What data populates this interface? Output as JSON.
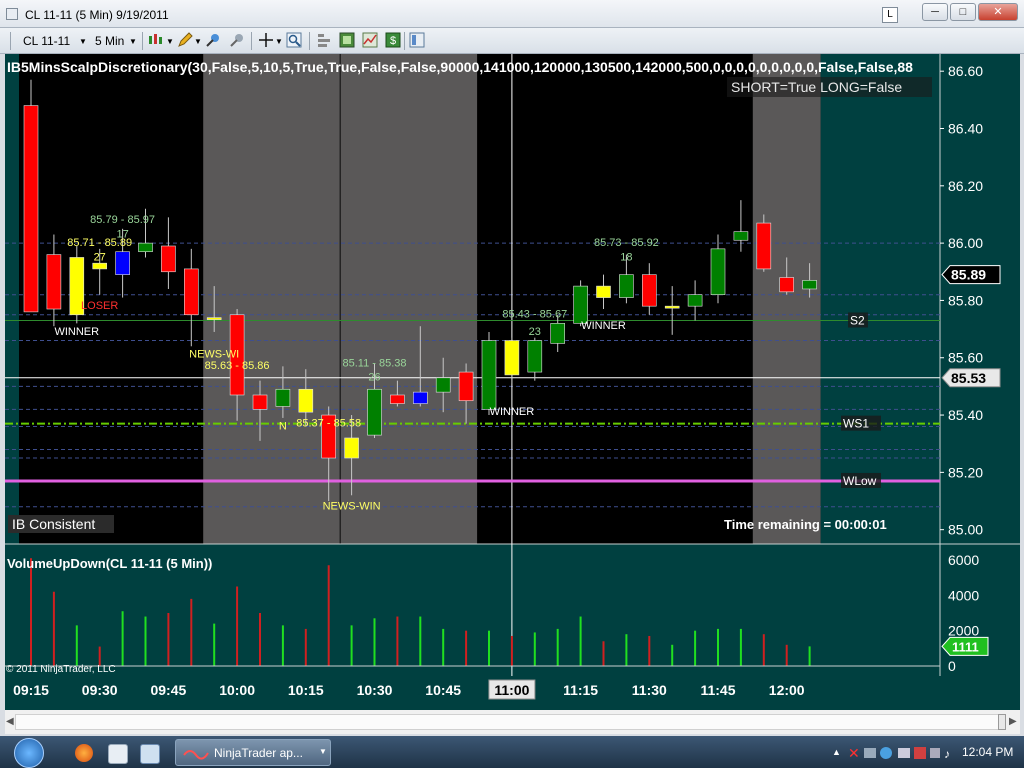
{
  "window": {
    "title": "CL 11-11 (5 Min)  9/19/2011",
    "layout_button": "L",
    "minimize": "─",
    "maximize": "□",
    "close": "✕"
  },
  "toolbar": {
    "instrument": "CL 11-11",
    "interval": "5 Min",
    "icons": [
      "bar-type-icon",
      "pencil-icon",
      "marker-icon",
      "pin-icon",
      "crosshair-icon",
      "zoom-icon",
      "properties-icon",
      "data-box-icon",
      "chart-trader-icon",
      "dollar-icon",
      "template-icon"
    ]
  },
  "chart_data": [
    {
      "type": "candlestick",
      "title": "IB5MinsScalpDiscretionary(30,False,5,10,5,True,True,False,False,90000,141000,120000,130500,142000,500,0,0,0,0,0,0,0,0,0,False,False,88",
      "subtitle": "SHORT=True LONG=False",
      "ylim": [
        84.95,
        86.66
      ],
      "yticks": [
        "86.60",
        "86.40",
        "86.20",
        "86.00",
        "85.80",
        "85.60",
        "85.40",
        "85.20",
        "85.00"
      ],
      "price_flags": [
        {
          "label": "85.89",
          "value": 85.89,
          "style": "dark"
        },
        {
          "label": "85.53",
          "value": 85.53,
          "style": "light"
        }
      ],
      "levels": [
        {
          "name": "S2",
          "value": 85.73,
          "color": "#2e8b2e"
        },
        {
          "name": "WS1",
          "value": 85.37,
          "color": "#66cc00"
        },
        {
          "name": "WLow",
          "value": 85.17,
          "color": "#e060e0"
        }
      ],
      "gridlines": [
        86.0,
        85.82,
        85.75,
        85.66,
        85.5,
        85.42,
        85.36,
        85.28,
        85.25,
        85.08
      ],
      "crosshair": {
        "price": 85.53,
        "time": "11:00"
      },
      "shaded_bands": [
        {
          "from": "09:55",
          "to": "10:20"
        },
        {
          "from": "10:25",
          "to": "10:50"
        },
        {
          "from": "11:55",
          "to": "12:05"
        }
      ],
      "candles": [
        {
          "t": "09:15",
          "o": 86.48,
          "h": 86.57,
          "l": 85.78,
          "c": 85.76,
          "color": "red"
        },
        {
          "t": "09:20",
          "o": 85.96,
          "h": 86.03,
          "l": 85.71,
          "c": 85.77,
          "color": "red"
        },
        {
          "t": "09:25",
          "o": 85.75,
          "h": 85.99,
          "l": 85.72,
          "c": 85.95,
          "color": "yellow"
        },
        {
          "t": "09:30",
          "o": 85.93,
          "h": 85.98,
          "l": 85.82,
          "c": 85.91,
          "color": "yellow"
        },
        {
          "t": "09:35",
          "o": 85.97,
          "h": 86.05,
          "l": 85.81,
          "c": 85.89,
          "color": "blue"
        },
        {
          "t": "09:40",
          "o": 85.97,
          "h": 86.12,
          "l": 85.95,
          "c": 86.0,
          "color": "green"
        },
        {
          "t": "09:45",
          "o": 85.99,
          "h": 86.09,
          "l": 85.84,
          "c": 85.9,
          "color": "red"
        },
        {
          "t": "09:50",
          "o": 85.91,
          "h": 85.98,
          "l": 85.64,
          "c": 85.75,
          "color": "red"
        },
        {
          "t": "09:55",
          "o": 85.74,
          "h": 85.85,
          "l": 85.69,
          "c": 85.74,
          "color": "yellow"
        },
        {
          "t": "10:00",
          "o": 85.75,
          "h": 85.77,
          "l": 85.38,
          "c": 85.47,
          "color": "red"
        },
        {
          "t": "10:05",
          "o": 85.47,
          "h": 85.52,
          "l": 85.31,
          "c": 85.42,
          "color": "red"
        },
        {
          "t": "10:10",
          "o": 85.43,
          "h": 85.57,
          "l": 85.39,
          "c": 85.49,
          "color": "green"
        },
        {
          "t": "10:15",
          "o": 85.49,
          "h": 85.56,
          "l": 85.36,
          "c": 85.41,
          "color": "yellow"
        },
        {
          "t": "10:20",
          "o": 85.4,
          "h": 85.43,
          "l": 85.1,
          "c": 85.25,
          "color": "red"
        },
        {
          "t": "10:25",
          "o": 85.25,
          "h": 85.4,
          "l": 85.12,
          "c": 85.32,
          "color": "yellow"
        },
        {
          "t": "10:30",
          "o": 85.33,
          "h": 85.58,
          "l": 85.32,
          "c": 85.49,
          "color": "green"
        },
        {
          "t": "10:35",
          "o": 85.47,
          "h": 85.52,
          "l": 85.43,
          "c": 85.44,
          "color": "red"
        },
        {
          "t": "10:40",
          "o": 85.44,
          "h": 85.71,
          "l": 85.43,
          "c": 85.48,
          "color": "blue"
        },
        {
          "t": "10:45",
          "o": 85.48,
          "h": 85.6,
          "l": 85.41,
          "c": 85.53,
          "color": "green"
        },
        {
          "t": "10:50",
          "o": 85.55,
          "h": 85.58,
          "l": 85.37,
          "c": 85.45,
          "color": "red"
        },
        {
          "t": "10:55",
          "o": 85.42,
          "h": 85.69,
          "l": 85.4,
          "c": 85.66,
          "color": "green"
        },
        {
          "t": "11:00",
          "o": 85.66,
          "h": 85.67,
          "l": 85.51,
          "c": 85.54,
          "color": "yellow"
        },
        {
          "t": "11:05",
          "o": 85.55,
          "h": 85.67,
          "l": 85.52,
          "c": 85.66,
          "color": "green"
        },
        {
          "t": "11:10",
          "o": 85.65,
          "h": 85.75,
          "l": 85.62,
          "c": 85.72,
          "color": "green"
        },
        {
          "t": "11:15",
          "o": 85.72,
          "h": 85.87,
          "l": 85.71,
          "c": 85.85,
          "color": "green"
        },
        {
          "t": "11:20",
          "o": 85.85,
          "h": 85.89,
          "l": 85.77,
          "c": 85.81,
          "color": "yellow"
        },
        {
          "t": "11:25",
          "o": 85.81,
          "h": 85.96,
          "l": 85.79,
          "c": 85.89,
          "color": "green"
        },
        {
          "t": "11:30",
          "o": 85.89,
          "h": 85.93,
          "l": 85.75,
          "c": 85.78,
          "color": "red"
        },
        {
          "t": "11:35",
          "o": 85.78,
          "h": 85.85,
          "l": 85.68,
          "c": 85.78,
          "color": "yellow"
        },
        {
          "t": "11:40",
          "o": 85.78,
          "h": 85.87,
          "l": 85.73,
          "c": 85.82,
          "color": "green"
        },
        {
          "t": "11:45",
          "o": 85.82,
          "h": 86.03,
          "l": 85.79,
          "c": 85.98,
          "color": "green"
        },
        {
          "t": "11:50",
          "o": 86.01,
          "h": 86.15,
          "l": 85.97,
          "c": 86.04,
          "color": "green"
        },
        {
          "t": "11:55",
          "o": 86.07,
          "h": 86.1,
          "l": 85.9,
          "c": 85.91,
          "color": "red"
        },
        {
          "t": "12:00",
          "o": 85.88,
          "h": 85.95,
          "l": 85.82,
          "c": 85.83,
          "color": "red"
        },
        {
          "t": "12:05",
          "o": 85.84,
          "h": 85.93,
          "l": 85.81,
          "c": 85.87,
          "color": "green"
        }
      ],
      "annotations": [
        {
          "text": "85.79 - 85.97",
          "t": "09:35",
          "price": 86.07,
          "color": "#99d499"
        },
        {
          "text": "85.71 - 85.89",
          "t": "09:30",
          "price": 85.99,
          "color": "#ffff66"
        },
        {
          "text": "17",
          "t": "09:35",
          "price": 86.02,
          "color": "#99d499"
        },
        {
          "text": "27",
          "t": "09:30",
          "price": 85.94,
          "color": "#ffff66"
        },
        {
          "text": "LOSER",
          "t": "09:30",
          "price": 85.77,
          "color": "#ff3030"
        },
        {
          "text": "WINNER",
          "t": "09:25",
          "price": 85.68,
          "color": "#ffffff"
        },
        {
          "text": "NEWS-WI",
          "t": "09:55",
          "price": 85.6,
          "color": "#ffff66"
        },
        {
          "text": "85.63 - 85.86",
          "t": "10:00",
          "price": 85.56,
          "color": "#ffff66"
        },
        {
          "text": "85.11 - 85.38",
          "t": "10:30",
          "price": 85.57,
          "color": "#99d499"
        },
        {
          "text": "26",
          "t": "10:30",
          "price": 85.52,
          "color": "#99d499"
        },
        {
          "text": "N",
          "t": "10:10",
          "price": 85.35,
          "color": "#ffff66"
        },
        {
          "text": "85.37 - 85.58",
          "t": "10:20",
          "price": 85.36,
          "color": "#ffff66"
        },
        {
          "text": "NEWS-WIN",
          "t": "10:25",
          "price": 85.07,
          "color": "#ffff66"
        },
        {
          "text": "WINNER",
          "t": "11:00",
          "price": 85.4,
          "color": "#ffffff"
        },
        {
          "text": "85.43 - 85.67",
          "t": "11:05",
          "price": 85.74,
          "color": "#99d499"
        },
        {
          "text": "23",
          "t": "11:05",
          "price": 85.68,
          "color": "#99d499"
        },
        {
          "text": "85.73 - 85.92",
          "t": "11:25",
          "price": 85.99,
          "color": "#99d499"
        },
        {
          "text": "18",
          "t": "11:25",
          "price": 85.94,
          "color": "#99d499"
        },
        {
          "text": "WINNER",
          "t": "11:20",
          "price": 85.7,
          "color": "#ffffff"
        }
      ],
      "status_left": "IB Consistent",
      "status_right": "Time remaining = 00:00:01"
    },
    {
      "type": "bar",
      "title": "VolumeUpDown(CL 11-11 (5 Min))",
      "ylim": [
        0,
        6000
      ],
      "yticks": [
        "6000",
        "4000",
        "2000",
        "0"
      ],
      "last_value_flag": "1111",
      "categories": [
        "09:15",
        "09:20",
        "09:25",
        "09:30",
        "09:35",
        "09:40",
        "09:45",
        "09:50",
        "09:55",
        "10:00",
        "10:05",
        "10:10",
        "10:15",
        "10:20",
        "10:25",
        "10:30",
        "10:35",
        "10:40",
        "10:45",
        "10:50",
        "10:55",
        "11:00",
        "11:05",
        "11:10",
        "11:15",
        "11:20",
        "11:25",
        "11:30",
        "11:35",
        "11:40",
        "11:45",
        "11:50",
        "11:55",
        "12:00",
        "12:05"
      ],
      "values": [
        6100,
        4200,
        2300,
        1100,
        3100,
        2800,
        3000,
        3800,
        2400,
        4500,
        3000,
        2300,
        2100,
        5700,
        2300,
        2700,
        2800,
        2800,
        2100,
        2000,
        2000,
        1700,
        1900,
        2100,
        2800,
        1400,
        1800,
        1700,
        1200,
        2000,
        2100,
        2100,
        1800,
        1200,
        1111
      ],
      "colors": [
        "red",
        "red",
        "green",
        "red",
        "green",
        "green",
        "red",
        "red",
        "green",
        "red",
        "red",
        "green",
        "red",
        "red",
        "green",
        "green",
        "red",
        "green",
        "green",
        "red",
        "green",
        "red",
        "green",
        "green",
        "green",
        "red",
        "green",
        "red",
        "green",
        "green",
        "green",
        "green",
        "red",
        "red",
        "green"
      ],
      "copyright": "© 2011 NinjaTrader, LLC"
    }
  ],
  "xaxis": {
    "labels": [
      "09:15",
      "09:30",
      "09:45",
      "10:00",
      "10:15",
      "10:30",
      "10:45",
      "11:00",
      "11:15",
      "11:30",
      "11:45",
      "12:00"
    ],
    "highlight": "11:00"
  },
  "taskbar": {
    "task_label": "NinjaTrader ap...",
    "clock": "12:04 PM",
    "tray_up": "▲"
  }
}
